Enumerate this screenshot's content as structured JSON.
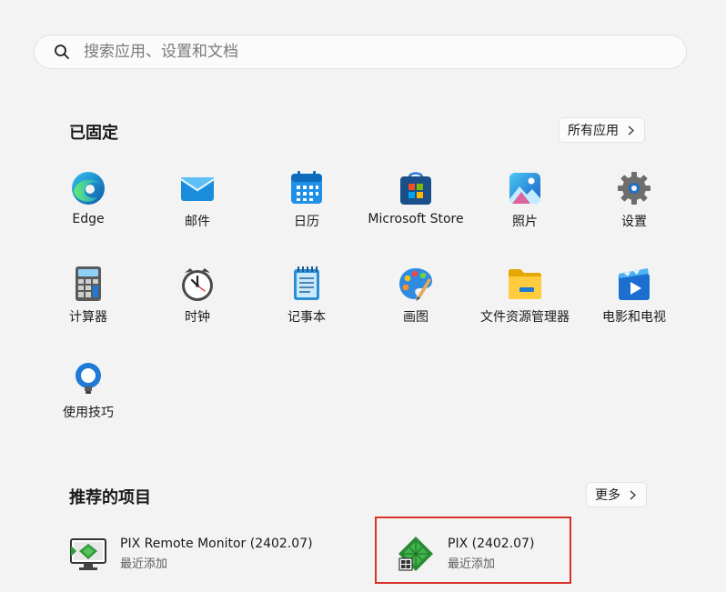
{
  "search": {
    "placeholder": "搜索应用、设置和文档",
    "icon": "search-icon"
  },
  "pinned": {
    "title": "已固定",
    "all_apps_label": "所有应用",
    "apps": [
      {
        "label": "Edge",
        "icon": "edge-icon"
      },
      {
        "label": "邮件",
        "icon": "mail-icon"
      },
      {
        "label": "日历",
        "icon": "calendar-icon"
      },
      {
        "label": "Microsoft Store",
        "icon": "store-icon"
      },
      {
        "label": "照片",
        "icon": "photos-icon"
      },
      {
        "label": "设置",
        "icon": "settings-icon"
      },
      {
        "label": "计算器",
        "icon": "calculator-icon"
      },
      {
        "label": "时钟",
        "icon": "clock-icon"
      },
      {
        "label": "记事本",
        "icon": "notepad-icon"
      },
      {
        "label": "画图",
        "icon": "paint-icon"
      },
      {
        "label": "文件资源管理器",
        "icon": "folder-icon"
      },
      {
        "label": "电影和电视",
        "icon": "movies-icon"
      },
      {
        "label": "使用技巧",
        "icon": "tips-icon"
      }
    ]
  },
  "recommended": {
    "title": "推荐的项目",
    "more_label": "更多",
    "items": [
      {
        "name": "PIX Remote Monitor (2402.07)",
        "sub": "最近添加",
        "icon": "pix-remote-monitor-icon"
      },
      {
        "name": "PIX (2402.07)",
        "sub": "最近添加",
        "icon": "pix-icon"
      }
    ]
  },
  "colors": {
    "background": "#f3f3f3",
    "highlight": "#d9302b"
  }
}
